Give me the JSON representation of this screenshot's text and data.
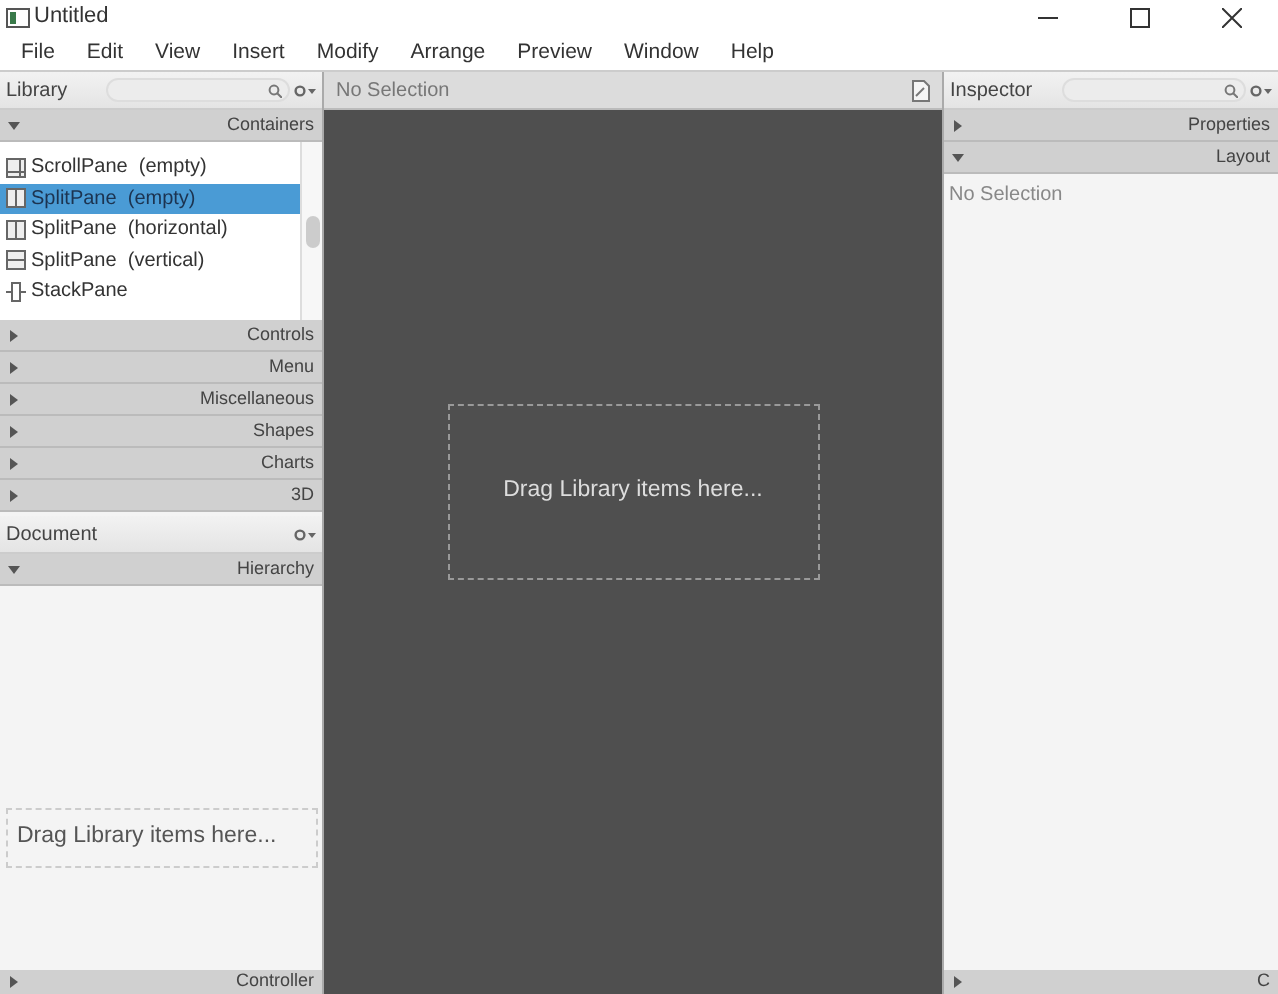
{
  "window": {
    "title": "Untitled"
  },
  "menu": [
    "File",
    "Edit",
    "View",
    "Insert",
    "Modify",
    "Arrange",
    "Preview",
    "Window",
    "Help"
  ],
  "library": {
    "title": "Library",
    "sections": [
      {
        "label": "Containers",
        "expanded": true,
        "items": [
          {
            "label": "ScrollPane  (empty)",
            "kind": "scroll",
            "selected": false
          },
          {
            "label": "SplitPane  (empty)",
            "kind": "split",
            "selected": true
          },
          {
            "label": "SplitPane  (horizontal)",
            "kind": "split",
            "selected": false
          },
          {
            "label": "SplitPane  (vertical)",
            "kind": "vsplit",
            "selected": false
          },
          {
            "label": "StackPane",
            "kind": "stack",
            "selected": false
          }
        ]
      },
      {
        "label": "Controls",
        "expanded": false
      },
      {
        "label": "Menu",
        "expanded": false
      },
      {
        "label": "Miscellaneous",
        "expanded": false
      },
      {
        "label": "Shapes",
        "expanded": false
      },
      {
        "label": "Charts",
        "expanded": false
      },
      {
        "label": "3D",
        "expanded": false
      }
    ]
  },
  "document": {
    "title": "Document",
    "sections": [
      {
        "label": "Hierarchy",
        "expanded": true
      }
    ],
    "drop_hint": "Drag Library items here...",
    "footer": {
      "label": "Controller",
      "expanded": false
    }
  },
  "canvas": {
    "selection": "No Selection",
    "drop_hint": "Drag Library items here..."
  },
  "inspector": {
    "title": "Inspector",
    "sections": [
      {
        "label": "Properties",
        "expanded": false
      },
      {
        "label": "Layout",
        "expanded": true
      }
    ],
    "selection": "No Selection",
    "footer": {
      "label": "C",
      "expanded": false
    }
  }
}
